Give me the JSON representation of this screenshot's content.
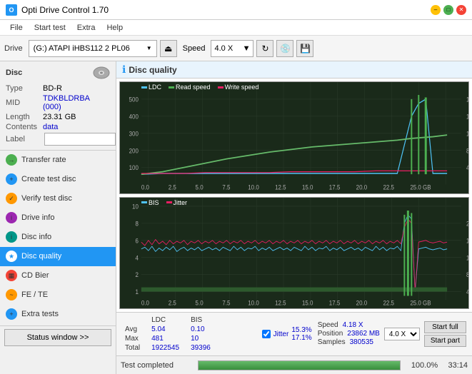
{
  "app": {
    "title": "Opti Drive Control 1.70",
    "icon": "ODC"
  },
  "titlebar": {
    "minimize": "–",
    "maximize": "□",
    "close": "✕"
  },
  "menubar": {
    "items": [
      "File",
      "Start test",
      "Extra",
      "Help"
    ]
  },
  "toolbar": {
    "drive_label": "Drive",
    "drive_value": "(G:) ATAPI iHBS112  2 PL06",
    "speed_label": "Speed",
    "speed_value": "4.0 X"
  },
  "disc": {
    "section_title": "Disc",
    "type_label": "Type",
    "type_value": "BD-R",
    "mid_label": "MID",
    "mid_value": "TDKBLDRBA (000)",
    "length_label": "Length",
    "length_value": "23.31 GB",
    "contents_label": "Contents",
    "contents_value": "data",
    "label_label": "Label",
    "label_value": ""
  },
  "sidebar": {
    "items": [
      {
        "id": "transfer-rate",
        "label": "Transfer rate",
        "icon_color": "green"
      },
      {
        "id": "create-test-disc",
        "label": "Create test disc",
        "icon_color": "blue"
      },
      {
        "id": "verify-test-disc",
        "label": "Verify test disc",
        "icon_color": "orange"
      },
      {
        "id": "drive-info",
        "label": "Drive info",
        "icon_color": "purple"
      },
      {
        "id": "disc-info",
        "label": "Disc info",
        "icon_color": "teal"
      },
      {
        "id": "disc-quality",
        "label": "Disc quality",
        "icon_color": "cyan",
        "active": true
      },
      {
        "id": "cd-bier",
        "label": "CD Bier",
        "icon_color": "red"
      },
      {
        "id": "fe-te",
        "label": "FE / TE",
        "icon_color": "orange"
      },
      {
        "id": "extra-tests",
        "label": "Extra tests",
        "icon_color": "blue"
      }
    ],
    "status_window": "Status window >>"
  },
  "disc_quality": {
    "title": "Disc quality",
    "legend": {
      "ldc": "LDC",
      "read_speed": "Read speed",
      "write_speed": "Write speed",
      "bis": "BIS",
      "jitter": "Jitter"
    }
  },
  "stats": {
    "headers": [
      "",
      "LDC",
      "BIS",
      "",
      "Jitter",
      "Speed",
      ""
    ],
    "rows": [
      {
        "label": "Avg",
        "ldc": "5.04",
        "bis": "0.10",
        "jitter": "15.3%",
        "speed_key": "Position",
        "speed_val": "23862 MB"
      },
      {
        "label": "Max",
        "ldc": "481",
        "bis": "10",
        "jitter": "17.1%",
        "speed_key": "Samples",
        "speed_val": "380535"
      },
      {
        "label": "Total",
        "ldc": "1922545",
        "bis": "39396",
        "jitter": ""
      }
    ],
    "jitter_checked": true,
    "jitter_label": "Jitter",
    "current_speed_label": "Speed",
    "current_speed_value": "4.18 X",
    "speed_select": "4.0 X",
    "start_full": "Start full",
    "start_part": "Start part"
  },
  "bottom": {
    "status_text": "Test completed",
    "progress_percent": "100.0%",
    "time": "33:14"
  }
}
